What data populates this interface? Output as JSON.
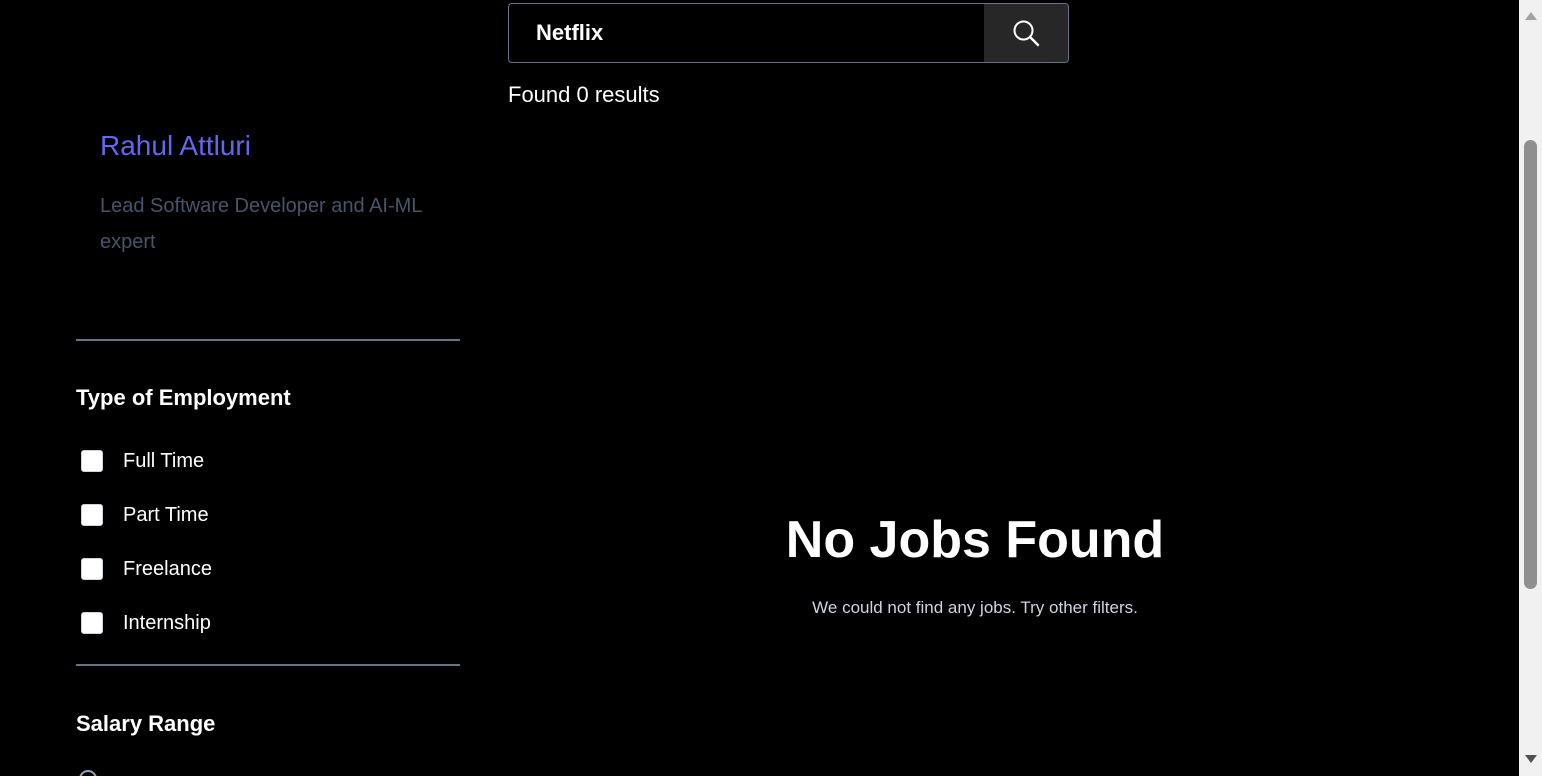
{
  "profile": {
    "name": "Rahul Attluri",
    "bio": "Lead Software Developer and AI-ML expert"
  },
  "filters": {
    "employment_heading": "Type of Employment",
    "employment_types": [
      {
        "label": "Full Time",
        "checked": false
      },
      {
        "label": "Part Time",
        "checked": false
      },
      {
        "label": "Freelance",
        "checked": false
      },
      {
        "label": "Internship",
        "checked": false
      }
    ],
    "salary_heading": "Salary Range"
  },
  "search": {
    "value": "Netflix",
    "icon": "search-icon"
  },
  "results": {
    "count_text": "Found 0 results"
  },
  "empty_state": {
    "title": "No Jobs Found",
    "description": "We could not find any jobs. Try other filters."
  },
  "colors": {
    "background": "#000000",
    "accent": "#6366f1",
    "muted": "#475569",
    "divider": "#64748b"
  }
}
